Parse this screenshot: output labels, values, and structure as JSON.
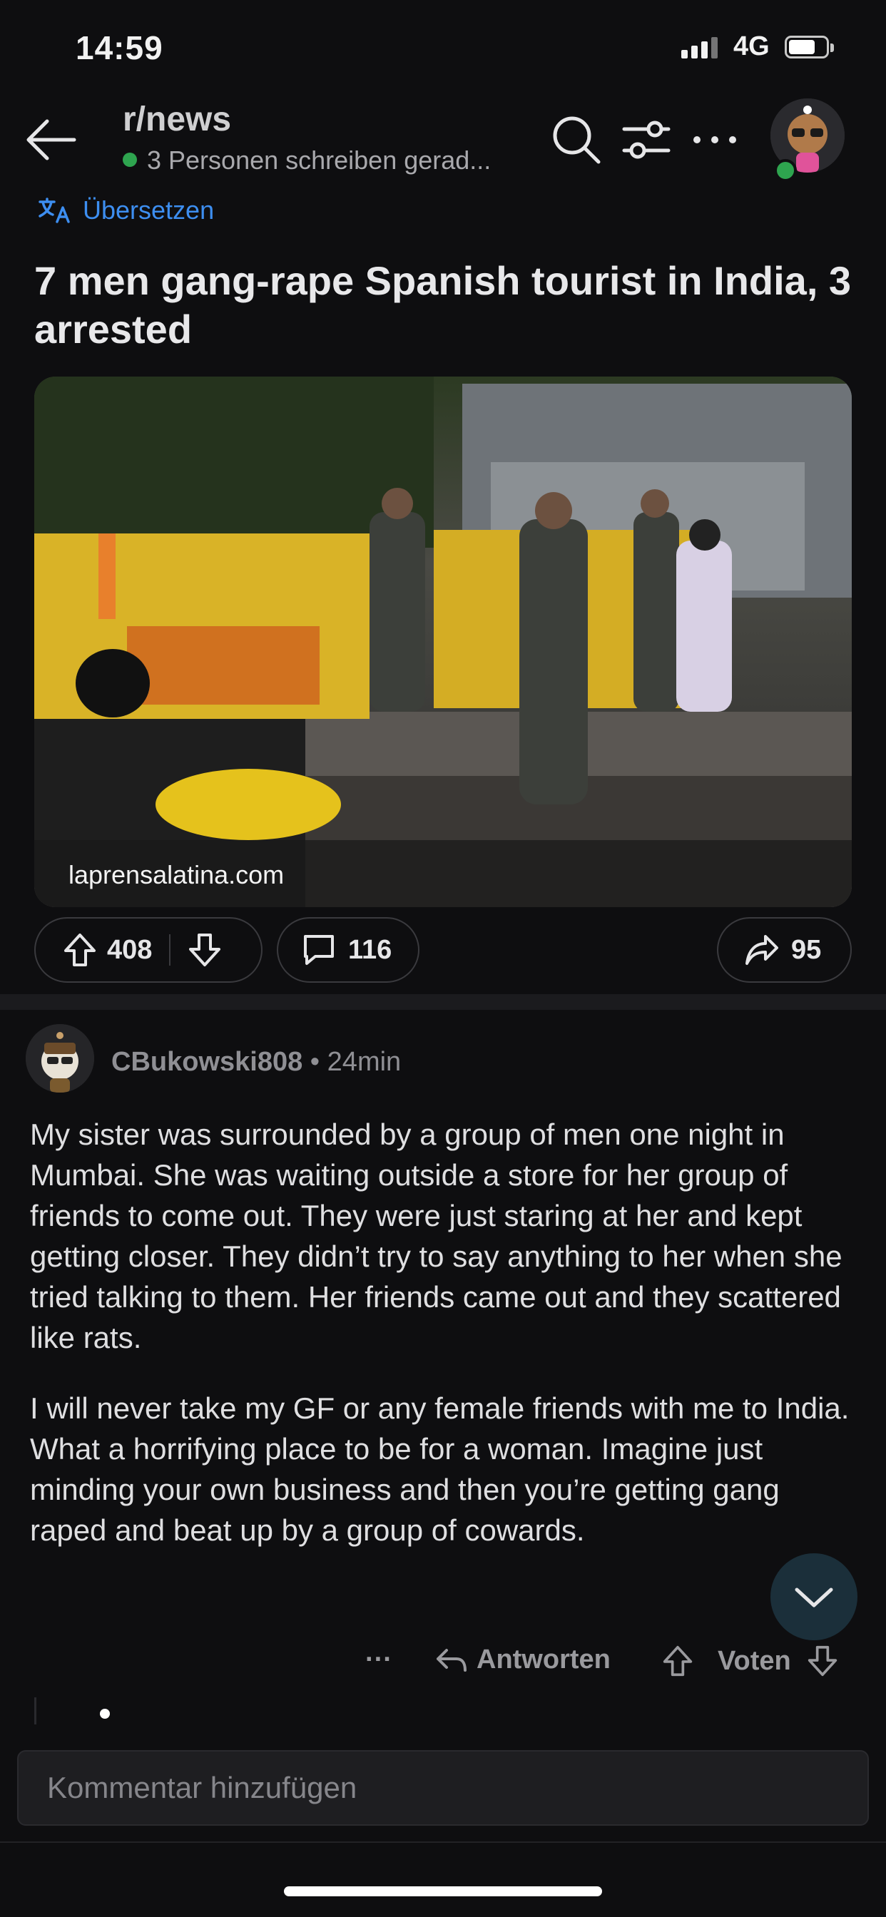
{
  "status_bar": {
    "time": "14:59",
    "network": "4G"
  },
  "header": {
    "subreddit": "r/news",
    "online_text": "3 Personen schreiben gerad..."
  },
  "translate_label": "Übersetzen",
  "post": {
    "title": "7 men gang-rape Spanish tourist in India, 3 arrested",
    "source": "laprensalatina.com",
    "upvotes": "408",
    "comments": "116",
    "shares": "95"
  },
  "comment": {
    "username": "CBukowski808",
    "age": "24min",
    "paragraphs": [
      "My sister was surrounded by a group of men one night in Mumbai. She was waiting outside a store for her group of friends to come out. They were just staring at her and kept getting closer. They didn’t try to say anything to her when she tried talking to them. Her friends came out and they scattered like rats.",
      "I will never take my GF or any female friends with me to India. What a horrifying place to be for a woman. Imagine just minding your own business and then you’re getting gang raped and beat up by a group of cowards."
    ],
    "more_label": "···",
    "reply_label": "Antworten",
    "vote_label": "Voten"
  },
  "composer": {
    "placeholder": "Kommentar hinzufügen"
  },
  "colors": {
    "accent_blue": "#3d8ef0",
    "online_green": "#2ea44f",
    "background": "#0e0e10"
  },
  "icons": [
    "back-arrow-icon",
    "search-icon",
    "filter-icon",
    "more-icon",
    "translate-icon",
    "upvote-icon",
    "downvote-icon",
    "comment-icon",
    "share-icon",
    "reply-icon",
    "chevron-down-icon"
  ]
}
